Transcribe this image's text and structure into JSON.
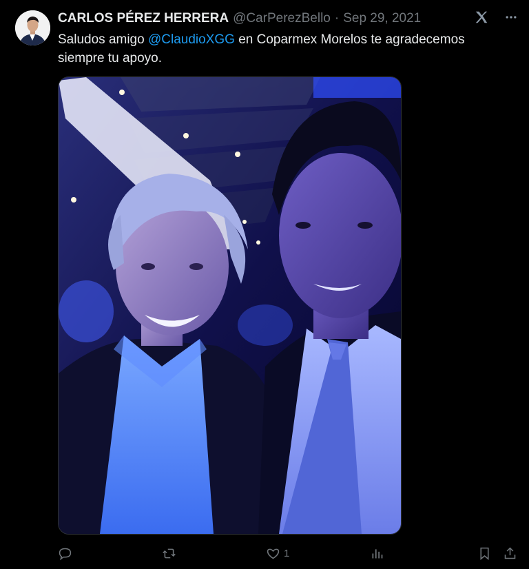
{
  "tweet": {
    "author_name": "CARLOS PÉREZ HERRERA",
    "handle": "@CarPerezBello",
    "separator": "·",
    "date": "Sep 29, 2021",
    "text_before": "Saludos amigo ",
    "mention": "@ClaudioXGG",
    "text_after": " en Coparmex Morelos te agradecemos siempre tu apoyo.",
    "media_description_icon": "photo"
  },
  "actions": {
    "reply_count": "",
    "repost_count": "",
    "like_count": "1",
    "views_count": ""
  },
  "colors": {
    "background": "#000000",
    "text": "#e7e9ea",
    "muted": "#71767b",
    "accent": "#1d9bf0"
  },
  "icons": [
    "grok-icon",
    "more-icon",
    "reply-icon",
    "repost-icon",
    "like-icon",
    "views-icon",
    "bookmark-icon",
    "share-icon"
  ]
}
